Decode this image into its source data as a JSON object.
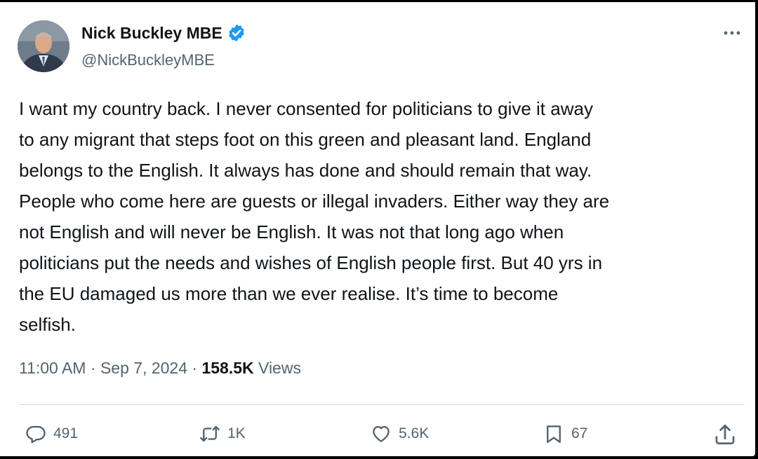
{
  "author": {
    "name": "Nick Buckley MBE",
    "handle": "@NickBuckleyMBE",
    "verified": true
  },
  "tweet": {
    "text": "I want my country back. I never consented for politicians to give it away\nto any migrant that steps foot on this green and pleasant land. England\nbelongs to the English. It always has done and should remain that way.\nPeople who come here are guests or illegal invaders. Either way they are\nnot English and will never be English. It was not that long ago when\npoliticians put the needs and wishes of English people first. But 40 yrs in\nthe EU damaged us more than we ever realise. It’s time to become\nselfish."
  },
  "meta": {
    "time": "11:00 AM",
    "separator": " · ",
    "date": "Sep 7, 2024",
    "views_count": "158.5K",
    "views_label": " Views"
  },
  "actions": {
    "replies": "491",
    "reposts": "1K",
    "likes": "5.6K",
    "bookmarks": "67"
  },
  "icons": {
    "verified": "verified-badge-icon",
    "more": "more-horizontal-icon",
    "reply": "reply-icon",
    "repost": "repost-icon",
    "like": "heart-icon",
    "bookmark": "bookmark-icon",
    "share": "share-icon"
  },
  "colors": {
    "accent": "#1d9bf0",
    "text_primary": "#0f1419",
    "text_secondary": "#536471",
    "divider": "#cfd9de"
  }
}
